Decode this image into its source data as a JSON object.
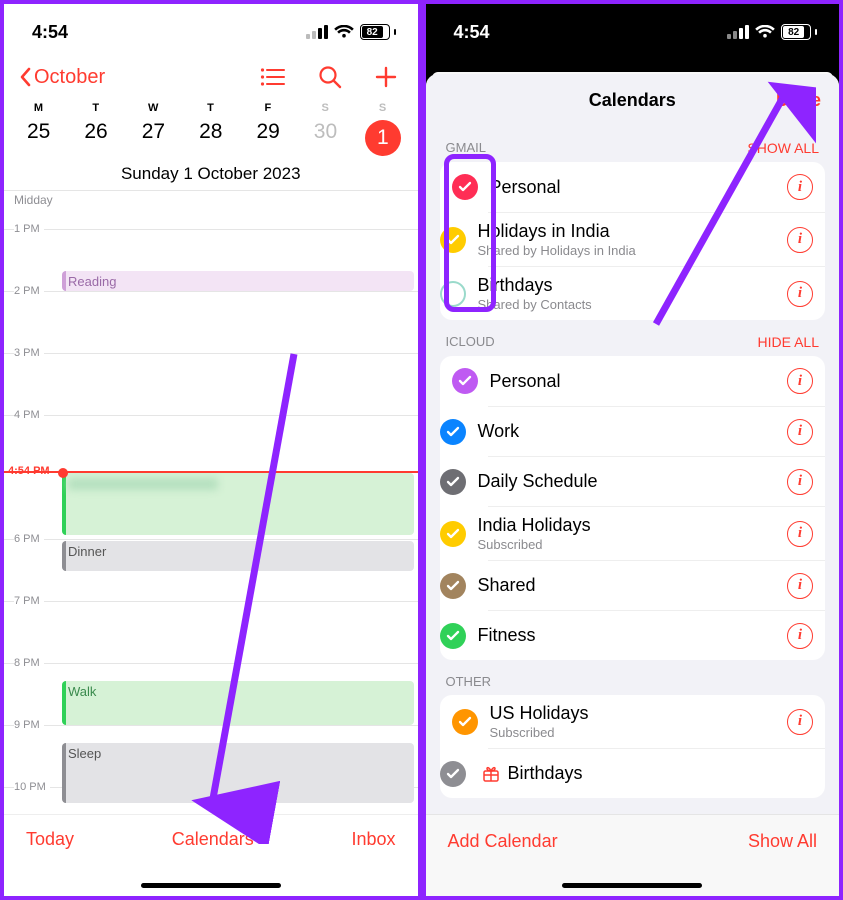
{
  "status": {
    "time": "4:54",
    "battery": "82"
  },
  "left": {
    "back_label": "October",
    "days_of_week": [
      "M",
      "T",
      "W",
      "T",
      "F",
      "S",
      "S"
    ],
    "dates": [
      "25",
      "26",
      "27",
      "28",
      "29",
      "30",
      "1"
    ],
    "selected_index": 6,
    "weekend_start_index": 5,
    "full_date": "Sunday  1 October 2023",
    "midday_label": "Midday",
    "hours": [
      "1 PM",
      "2 PM",
      "3 PM",
      "4 PM",
      "6 PM",
      "7 PM",
      "8 PM",
      "9 PM",
      "10 PM"
    ],
    "now_label": "4:54 PM",
    "events": {
      "reading": "Reading",
      "dinner": "Dinner",
      "walk": "Walk",
      "sleep": "Sleep"
    },
    "toolbar": {
      "today": "Today",
      "calendars": "Calendars",
      "inbox": "Inbox"
    }
  },
  "right": {
    "sheet_title": "Calendars",
    "done": "Done",
    "sections": {
      "gmail": {
        "header": "GMAIL",
        "action": "SHOW ALL",
        "items": [
          {
            "title": "Personal",
            "color": "#ff2d55",
            "checked": true
          },
          {
            "title": "Holidays in India",
            "sub": "Shared by Holidays in India",
            "color": "#ffcc00",
            "checked": true
          },
          {
            "title": "Birthdays",
            "sub": "Shared by Contacts",
            "color": "#34c7a9",
            "checked": false
          }
        ]
      },
      "icloud": {
        "header": "ICLOUD",
        "action": "HIDE ALL",
        "items": [
          {
            "title": "Personal",
            "color": "#bf5af2",
            "checked": true
          },
          {
            "title": "Work",
            "color": "#0a84ff",
            "checked": true
          },
          {
            "title": "Daily Schedule",
            "color": "#6e6e73",
            "checked": true
          },
          {
            "title": "India Holidays",
            "sub": "Subscribed",
            "color": "#ffcc00",
            "checked": true
          },
          {
            "title": "Shared",
            "color": "#a2845e",
            "checked": true
          },
          {
            "title": "Fitness",
            "color": "#30d158",
            "checked": true
          }
        ]
      },
      "other": {
        "header": "OTHER",
        "items": [
          {
            "title": "US Holidays",
            "sub": "Subscribed",
            "color": "#ff9500",
            "checked": true
          },
          {
            "title": "Birthdays",
            "color": "#8e8e93",
            "checked": true,
            "gift": true
          }
        ]
      }
    },
    "toolbar": {
      "add": "Add Calendar",
      "show_all": "Show All"
    }
  }
}
